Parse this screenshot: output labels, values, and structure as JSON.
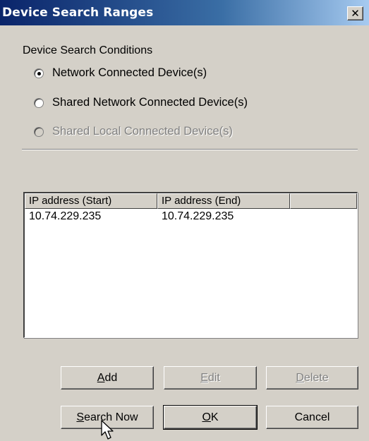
{
  "window": {
    "title": "Device Search Ranges",
    "close_glyph": "✕"
  },
  "conditions": {
    "group_label": "Device Search Conditions",
    "options": [
      {
        "label": "Network Connected Device(s)",
        "checked": true,
        "enabled": true
      },
      {
        "label": "Shared Network Connected Device(s)",
        "checked": false,
        "enabled": true
      },
      {
        "label": "Shared Local Connected Device(s)",
        "checked": false,
        "enabled": false
      }
    ]
  },
  "ip_list": {
    "columns": [
      "IP address (Start)",
      "IP address (End)"
    ],
    "rows": [
      {
        "start": "10.74.229.235",
        "end": "10.74.229.235"
      }
    ]
  },
  "buttons": {
    "add": {
      "accel": "A",
      "rest": "dd",
      "enabled": true
    },
    "edit": {
      "accel": "E",
      "rest": "dit",
      "enabled": false
    },
    "delete": {
      "accel": "D",
      "rest": "elete",
      "enabled": false
    },
    "search_now": {
      "accel": "S",
      "rest": "earch Now",
      "enabled": true
    },
    "ok": {
      "accel": "O",
      "rest": "K",
      "enabled": true
    },
    "cancel": {
      "label": "Cancel",
      "enabled": true
    }
  },
  "icons": {
    "cursor": "mouse-pointer-icon"
  }
}
